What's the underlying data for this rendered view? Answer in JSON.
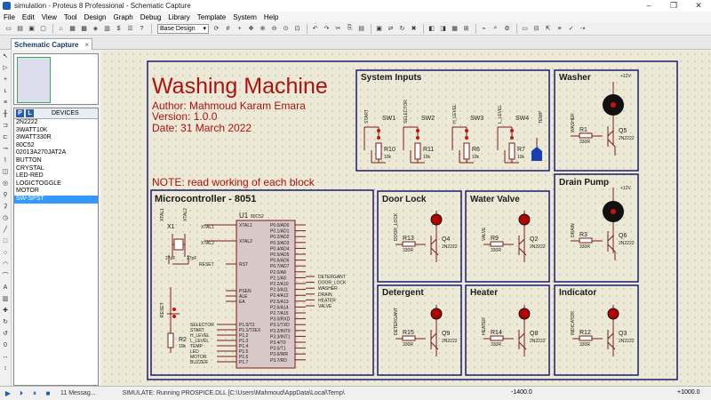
{
  "window": {
    "title": "simulation - Proteus 8 Professional - Schematic Capture",
    "minimize": "–",
    "maximize": "❐",
    "close": "✕"
  },
  "menu": [
    "File",
    "Edit",
    "View",
    "Tool",
    "Design",
    "Graph",
    "Debug",
    "Library",
    "Template",
    "System",
    "Help"
  ],
  "toolbar": {
    "layer": "Base Design"
  },
  "tab": {
    "label": "Schematic Capture",
    "close": "×"
  },
  "devices": {
    "p": "P",
    "l": "L",
    "header": "DEVICES",
    "items": [
      "2N2222",
      "3WATT10K",
      "3WATT330R",
      "80C52",
      "02013A270JAT2A",
      "BUTTON",
      "CRYSTAL",
      "LED-RED",
      "LOGICTOGGLE",
      "MOTOR",
      "SW-SPST"
    ],
    "selected": "SW-SPST"
  },
  "header_text": {
    "title": "Washing Machine",
    "author": "Author: Mahmoud Karam Emara",
    "version": "Version: 1.0.0",
    "date": "Date: 31 March 2022",
    "note": "NOTE: read working of each block"
  },
  "blocks": {
    "inputs": "System Inputs",
    "washer": "Washer",
    "mcu": "Microcontroller - 8051",
    "door": "Door Lock",
    "valve": "Water Valve",
    "drain": "Drain Pump",
    "detergent": "Detergent",
    "heater": "Heater",
    "indicator": "Indicator"
  },
  "inputs": {
    "switches": [
      {
        "net": "START",
        "sw": "SW1",
        "r": "R10",
        "rv": "10k"
      },
      {
        "net": "SELECTOR",
        "sw": "SW2",
        "r": "R11",
        "rv": "10k"
      },
      {
        "net": "H_LEVEL",
        "sw": "SW3",
        "r": "R6",
        "rv": "10k"
      },
      {
        "net": "L_LEVEL",
        "sw": "SW4",
        "r": "R7",
        "rv": "10k"
      }
    ],
    "temp": "TEMP"
  },
  "motors": [
    {
      "net": "WASHER",
      "r": "R1",
      "rv": "330R",
      "q": "Q5",
      "qv": "2N2222",
      "vcc": "+12V"
    },
    {
      "net": "DRAIN",
      "r": "R3",
      "rv": "330R",
      "q": "Q6",
      "qv": "2N2222",
      "vcc": "+12V"
    }
  ],
  "leds": [
    {
      "net": "DOOR_LOCK",
      "r": "R13",
      "rv": "330R",
      "q": "Q4",
      "qv": "2N2222"
    },
    {
      "net": "VALVE",
      "r": "R9",
      "rv": "330R",
      "q": "Q2",
      "qv": "2N2222"
    },
    {
      "net": "DETERGANT",
      "r": "R15",
      "rv": "330R",
      "q": "Q9",
      "qv": "2N2222"
    },
    {
      "net": "HEATER",
      "r": "R14",
      "rv": "330R",
      "q": "Q8",
      "qv": "2N2222"
    },
    {
      "net": "INDICATOR",
      "r": "R12",
      "rv": "330R",
      "q": "Q3",
      "qv": "2N2222"
    }
  ],
  "mcu": {
    "ref": "U1",
    "part": "80C52",
    "xtal": "X1",
    "c1": "27pF",
    "c2": "27pF",
    "r2": "R2",
    "r2v": "10k",
    "net_xtal1": "XTAL1",
    "net_xtal2": "XTAL2",
    "net_reset": "RESET",
    "left_pins": [
      "XTAL1",
      "XTAL2",
      "RST",
      "PSEN",
      "ALE",
      "EA",
      "P1.0/T2",
      "P1.1/T2EX",
      "P1.2",
      "P1.3",
      "P1.4",
      "P1.5",
      "P1.6",
      "P1.7"
    ],
    "right_pins": [
      "P0.0/AD0",
      "P0.1/AD1",
      "P0.2/AD2",
      "P0.3/AD3",
      "P0.4/AD4",
      "P0.5/AD5",
      "P0.6/AD6",
      "P0.7/AD7",
      "P2.0/A8",
      "P2.1/A9",
      "P2.2/A10",
      "P2.3/A11",
      "P2.4/A12",
      "P2.5/A13",
      "P2.6/A14",
      "P2.7/A15",
      "P3.0/RXD",
      "P3.1/TXD",
      "P3.2/INT0",
      "P3.3/INT1",
      "P3.4/T0",
      "P3.5/T1",
      "P3.6/WR",
      "P3.7/RD"
    ],
    "left_nets": [
      "SELECTOR",
      "START",
      "H_LEVEL",
      "L_LEVEL",
      "TEMP",
      "LED",
      "MOTOR",
      "BUZZER"
    ],
    "right_nets": [
      "DETERGANT",
      "DOOR_LOCK",
      "WASHER",
      "DRAIN",
      "HEATER",
      "VALVE"
    ]
  },
  "status": {
    "messages": "11 Messag...",
    "sim": "SIMULATE: Running PROSPICE.DLL [C:\\Users\\Mahmoud\\AppData\\Local\\Temp\\",
    "coord_x": "-1400.0",
    "coord_y": "+1000.0"
  },
  "colors": {
    "sheet_border": "#1a1a6e",
    "wire": "#7a1a1a",
    "title": "#b01010",
    "canvas": "#ecead6",
    "led": "#b00000"
  }
}
